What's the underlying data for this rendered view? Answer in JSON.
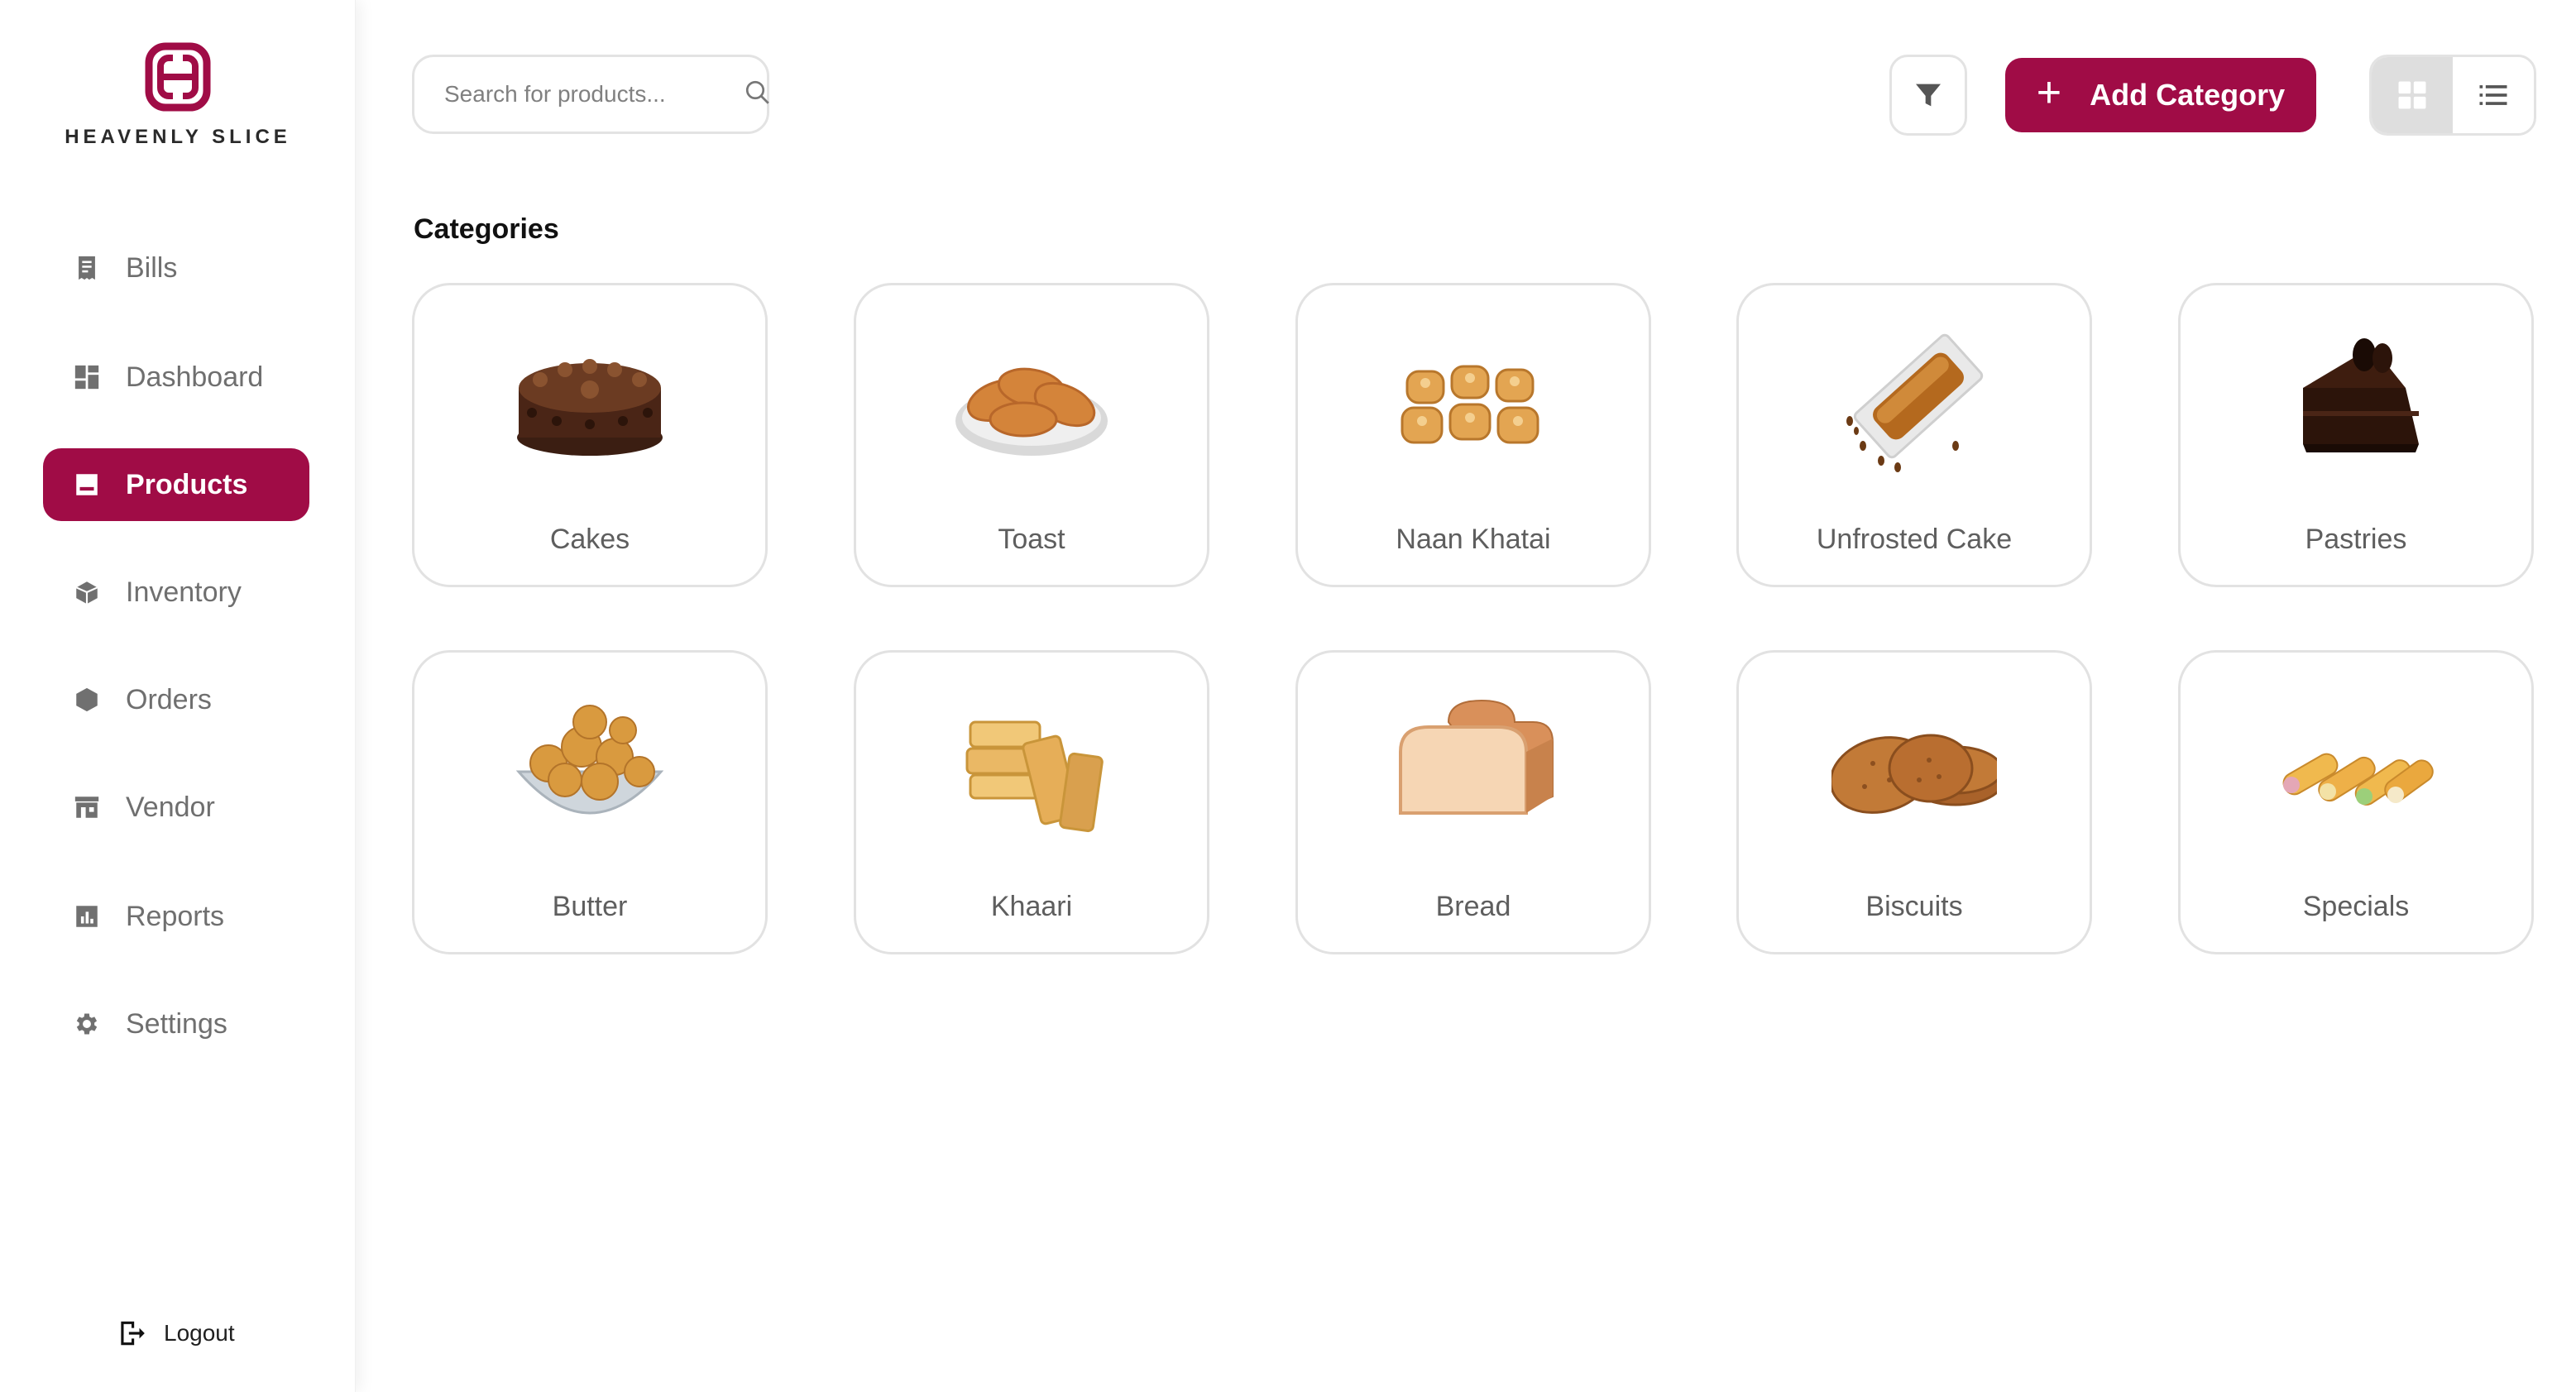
{
  "brand": {
    "name": "HEAVENLY SLICE",
    "accent": "#a00c46"
  },
  "sidebar": {
    "items": [
      {
        "label": "Bills",
        "icon": "receipt-icon"
      },
      {
        "label": "Dashboard",
        "icon": "dashboard-icon"
      },
      {
        "label": "Products",
        "icon": "products-icon",
        "active": true
      },
      {
        "label": "Inventory",
        "icon": "inventory-icon"
      },
      {
        "label": "Orders",
        "icon": "orders-icon"
      },
      {
        "label": "Vendor",
        "icon": "store-icon"
      },
      {
        "label": "Reports",
        "icon": "bar-chart-icon"
      },
      {
        "label": "Settings",
        "icon": "gear-icon"
      }
    ],
    "logout_label": "Logout"
  },
  "topbar": {
    "search_placeholder": "Search for products...",
    "add_label": "Add Category",
    "view_mode": "grid"
  },
  "main": {
    "section_title": "Categories",
    "categories": [
      {
        "label": "Cakes"
      },
      {
        "label": "Toast"
      },
      {
        "label": "Naan Khatai"
      },
      {
        "label": "Unfrosted Cake"
      },
      {
        "label": "Pastries"
      },
      {
        "label": "Butter"
      },
      {
        "label": "Khaari"
      },
      {
        "label": "Bread"
      },
      {
        "label": "Biscuits"
      },
      {
        "label": "Specials"
      }
    ]
  }
}
